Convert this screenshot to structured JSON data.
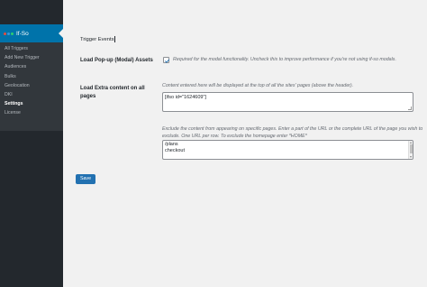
{
  "sidebar": {
    "plugin_name": "If-So",
    "logo_colors": [
      "#e74c3c",
      "#3498db",
      "#2ecc71"
    ],
    "items": [
      {
        "label": "All Triggers"
      },
      {
        "label": "Add New Trigger"
      },
      {
        "label": "Audiences"
      },
      {
        "label": "Bulks"
      },
      {
        "label": "Geolocation"
      },
      {
        "label": "DKI"
      },
      {
        "label": "Settings"
      },
      {
        "label": "License"
      }
    ],
    "active_item": "Settings"
  },
  "tab": {
    "label": "Trigger Events"
  },
  "settings": {
    "popup": {
      "label": "Load Pop-up (Modal) Assets",
      "checked": true,
      "description": "Required for the modal functionality. Uncheck this to improve performance if you're not using if-so modals."
    },
    "extra_content": {
      "label": "Load Extra content on all pages",
      "description": "Content entered here will be displayed at the top of all the sites' pages (above the header).",
      "value": "[ifso id=\"1624609\"]"
    },
    "exclude": {
      "description": "Exclude the content from appearing on specific pages. Enter a part of the URL or the complete URL of the page you wish to exclude. One URL per row. To exclude the homepage enter *HOME*",
      "lines": [
        "/plans",
        "checkout"
      ]
    }
  },
  "save_button": {
    "label": "Save"
  }
}
